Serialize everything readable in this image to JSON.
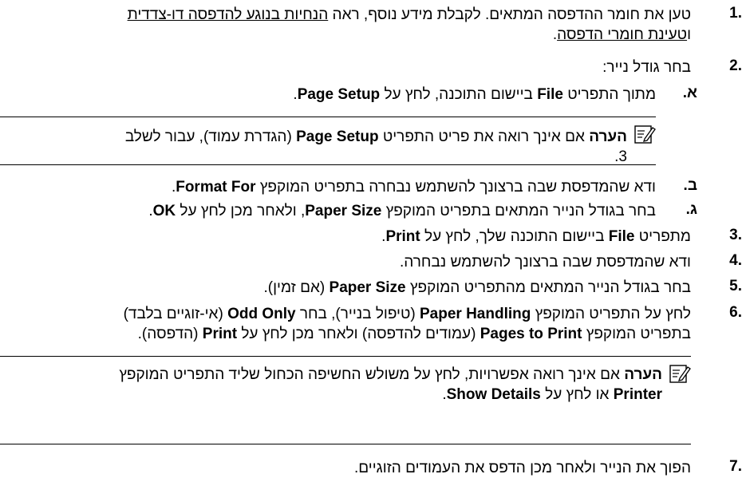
{
  "steps": {
    "s1": {
      "num": "1.",
      "line1_text": "טען את חומר ההדפסה המתאים. לקבלת מידע נוסף, ראה ",
      "line1_link": "הנחיות בנוגע להדפסה דו-צדדית",
      "line2_link_start": "ו",
      "line2_link": "טעינת חומרי הדפסה",
      "line2_end": "."
    },
    "s2": {
      "num": "2.",
      "text": "בחר גודל נייר:"
    },
    "s2a": {
      "letter": "א.",
      "t1": "מתוך התפריט ",
      "b1": "File",
      "t2": " ביישום התוכנה, לחץ על ",
      "b2": "Page Setup",
      "t3": "."
    },
    "note1": {
      "label": "הערה",
      "t1": "  אם אינך רואה את פריט התפריט ",
      "b1": "Page Setup",
      "t2": " (הגדרת עמוד), עבור לשלב",
      "line2": "3."
    },
    "s2b": {
      "letter": "ב.",
      "t1": "ודא שהמדפסת שבה ברצונך להשתמש נבחרה בתפריט המוקפץ ",
      "b1": "Format For",
      "t2": "."
    },
    "s2c": {
      "letter": "ג.",
      "t1": "בחר בגודל הנייר המתאים בתפריט המוקפץ ",
      "b1": "Paper Size",
      "t2": ", ולאחר מכן לחץ על ",
      "b2": "OK",
      "t3": "."
    },
    "s3": {
      "num": "3.",
      "t1": "מתפריט ",
      "b1": "File",
      "t2": " ביישום התוכנה שלך, לחץ על ",
      "b2": "Print",
      "t3": "."
    },
    "s4": {
      "num": "4.",
      "text": "ודא שהמדפסת שבה ברצונך להשתמש נבחרה."
    },
    "s5": {
      "num": "5.",
      "t1": "בחר בגודל הנייר המתאים מהתפריט המוקפץ ",
      "b1": "Paper Size",
      "t2": " (אם זמין)."
    },
    "s6": {
      "num": "6.",
      "t1": "לחץ על התפריט המוקפץ ",
      "b1": "Paper Handling",
      "t2": " (טיפול בנייר), בחר ",
      "b2": "Odd Only",
      "t3": " (אי-זוגיים בלבד)",
      "t4": "בתפריט המוקפץ ",
      "b3": "Pages to Print",
      "t5": " (עמודים להדפסה) ולאחר מכן לחץ על ",
      "b4": "Print",
      "t6": " (הדפסה)."
    },
    "note2": {
      "label": "הערה",
      "t1": "  אם אינך רואה אפשרויות, לחץ על משולש החשיפה הכחול שליד התפריט המוקפץ",
      "b1": "Printer",
      "t2": " או לחץ על ",
      "b2": "Show Details",
      "t3": "."
    },
    "s7": {
      "num": "7.",
      "text": "הפוך את הנייר ולאחר מכן הדפס את העמודים הזוגיים."
    }
  },
  "icons": {
    "note": "note-pencil-icon"
  }
}
